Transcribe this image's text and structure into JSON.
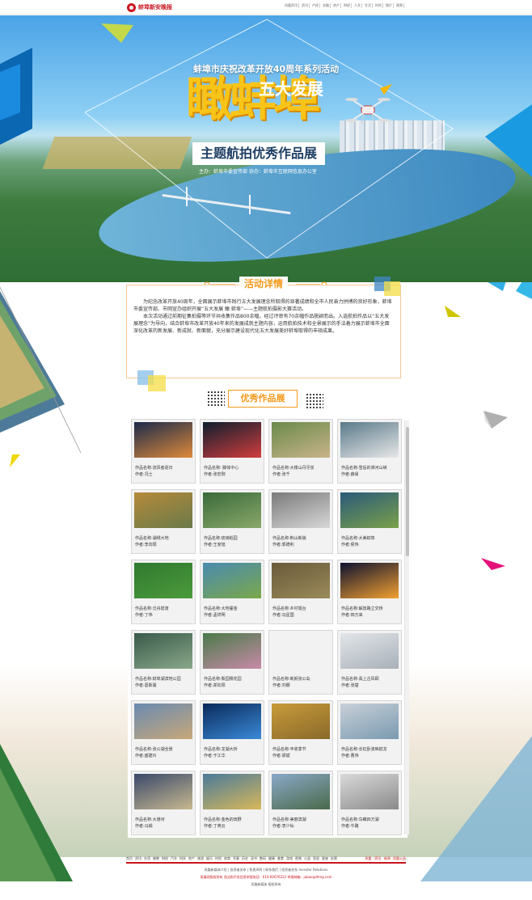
{
  "topbar": {
    "logo_text": "蚌埠新安晚报",
    "nav": [
      "凤凰资讯",
      "资讯",
      "产经",
      "金融",
      "房产",
      "财经",
      "人文",
      "生活",
      "时尚",
      "图片",
      "视频"
    ]
  },
  "banner": {
    "small_title": "蚌埠市庆祝改革开放40周年系列活动",
    "big_title": "瞰蚌埠",
    "five": "五大发展",
    "subtitle": "主题航拍优秀作品展",
    "host": "主办：蚌埠市委宣传部  协办：蚌埠市互联网信息办公室"
  },
  "details": {
    "title": "活动详情",
    "p1": "为纪念改革开放40周年，全面展示蚌埠市践行五大发展理念所取得的显著成绩和全市人民奋力拼搏的良好形象，蚌埠市委宣传部、市网宣办组织开展“五大发展 瞰 蚌埠”——主题航拍摄影大赛活动。",
    "p2": "本次活动通过前期征集拍摄等环节共收集作品800余幅，经过评审有70余幅作品脱颖而出。入选航拍作品以“五大发展理念”为导向，结合蚌埠市改革开放40年来的发展成就主题内容，运用航拍技术和全景展示的手法着力展示蚌埠市全面深化改革的新发展、新成就、新面貌，充分展示建设现代化五大发展美好蚌埠取得的丰硕成果。"
  },
  "works": {
    "title": "优秀作品展",
    "items": [
      {
        "name": "作品名称:流风者逐日",
        "author": "作者:况士"
      },
      {
        "name": "作品名称: 滕体中心",
        "author": "作者:张宏刚"
      },
      {
        "name": "作品名称:大楼山丹牙泉",
        "author": "作者:张千"
      },
      {
        "name": "作品名称:雪后的淮河山峡",
        "author": "作者:薛易"
      },
      {
        "name": "作品名称:湖绣大地",
        "author": "作者:李向阳"
      },
      {
        "name": "作品名称:琉璃稻园",
        "author": "作者:王家旭"
      },
      {
        "name": "作品名称:荆山新貌",
        "author": "作者:郭德利"
      },
      {
        "name": "作品名称:大美蚌埠",
        "author": "作者:侯伟"
      },
      {
        "name": "作品名称:泛舟碧波",
        "author": "作者:丁伟"
      },
      {
        "name": "作品名称:大地鎏金",
        "author": "作者:孟祥明"
      },
      {
        "name": "作品名称:乡村墟台",
        "author": "作者:冯星国"
      },
      {
        "name": "作品名称:解放路立交桥",
        "author": "作者:田万来"
      },
      {
        "name": "作品名称:蚌埠湖滨地公园",
        "author": "作者:葛斯骏"
      },
      {
        "name": "作品名称:梨园樱花园",
        "author": "作者:郑向阳"
      },
      {
        "name": "作品名称:新颜张公岛",
        "author": "作者:刘娜"
      },
      {
        "name": "作品名称:禹上古风颐",
        "author": "作者:张楚"
      },
      {
        "name": "作品名称:张公湖全景",
        "author": "作者:盛建玲"
      },
      {
        "name": "作品名称:龙湖大桥",
        "author": "作者:于江华"
      },
      {
        "name": "作品名称:丰收季节",
        "author": "作者:梁斌"
      },
      {
        "name": "作品名称:长虹卧波映蚌龙",
        "author": "作者:曹伟"
      },
      {
        "name": "作品名称:大港河",
        "author": "作者:马娟"
      },
      {
        "name": "作品名称:金色的田野",
        "author": "作者:丁英云"
      },
      {
        "name": "作品名称:美丽滨湖",
        "author": "作者:李少仙"
      },
      {
        "name": "作品名称:鸟瞰四方湖",
        "author": "作者:牛路"
      }
    ]
  },
  "footer": {
    "nav": [
      "首页",
      "资讯",
      "台湾",
      "佛教",
      "财经",
      "汽车",
      "科技",
      "房产",
      "旅游",
      "娱乐",
      "时尚",
      "体育",
      "军事",
      "历史",
      "读书",
      "数码",
      "健康",
      "美食",
      "游戏",
      "视频",
      "公益",
      "家居",
      "星座",
      "彩票"
    ],
    "nav_right": "凤凰 · 资讯 · 新闻",
    "nav_right2": "凤凰公益",
    "line1": "凤凰新媒体介绍 | 投资者关系 | 免责声明 | 联系我们 | 投资者关系 Investor Relations",
    "line2": "凤凰网版权所有   违法和不良信息举报电话：010-60676222   举报邮箱：jubao@ifeng.com",
    "line3": "凤凰新媒体 版权所有"
  },
  "colors": {
    "accent": "#f39a1c",
    "brand_red": "#c9151e",
    "title_yellow": "#f9c418"
  }
}
